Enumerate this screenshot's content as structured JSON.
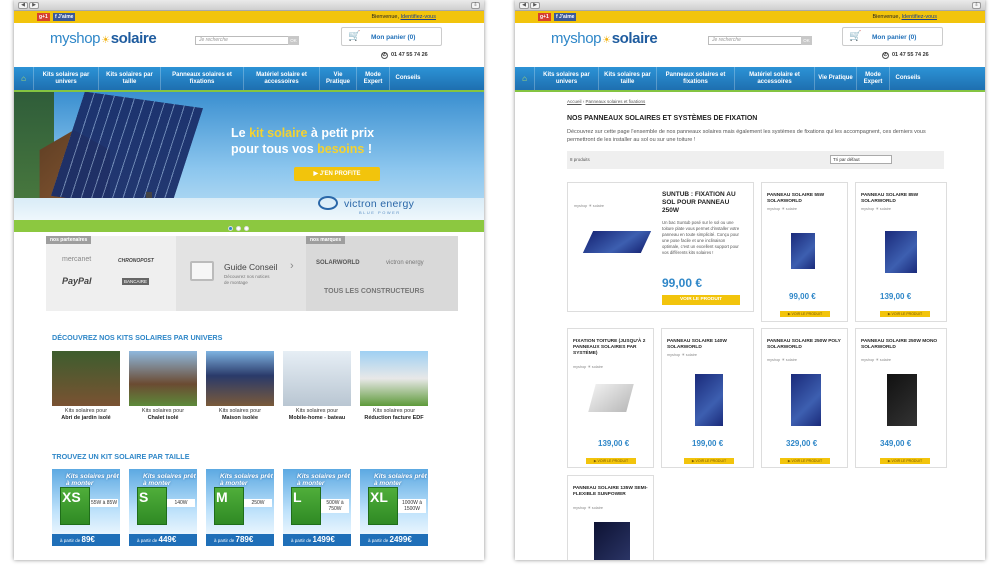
{
  "browser": {
    "back": "◀",
    "forward": "▶",
    "download": "⇩"
  },
  "common": {
    "social": {
      "gplus": "g+1",
      "fb": "f J'aime"
    },
    "welcome_text": "Bienvenue, ",
    "welcome_link": "Identifiez-vous",
    "logo": {
      "part1": "myshop",
      "sun": "☀",
      "part2": "solaire"
    },
    "search_placeholder": "Je recherche",
    "search_button": "OK",
    "cart_label": "Mon panier (0)",
    "cart_icon": "cart-icon",
    "phone": "01 47 55 74 26",
    "menu": [
      {
        "label": "Kits solaires par univers"
      },
      {
        "label": "Kits solaires par taille"
      },
      {
        "label": "Panneaux solaires et fixations"
      },
      {
        "label": "Matériel solaire et accessoires"
      },
      {
        "label": "Vie Pratique"
      },
      {
        "label": "Mode Expert"
      },
      {
        "label": "Conseils"
      }
    ]
  },
  "left": {
    "hero": {
      "line1_a": "Le ",
      "line1_b": "kit solaire",
      "line1_c": " à petit prix",
      "line2_a": "pour tous vos ",
      "line2_b": "besoins",
      "line2_c": " !",
      "cta": "▶ J'EN PROFITE",
      "brand": "victron energy",
      "brand_sub": "BLUE POWER"
    },
    "partners": {
      "label": "nos partenaires",
      "logos": [
        "mercanet",
        "CHRONOPOST",
        "PayPal",
        "BANCAIRE"
      ],
      "guide_title": "Guide Conseil",
      "guide_text": "Découvrez nos notices de montage",
      "guide_arrow": "›",
      "brands_label": "nos marques",
      "brand_logos": [
        "SOLARWORLD",
        "victron energy"
      ],
      "constructors": "TOUS LES CONSTRUCTEURS"
    },
    "univers_title": "DÉCOUVREZ NOS KITS SOLAIRES PAR UNIVERS",
    "univers": [
      {
        "l1": "Kits solaires pour",
        "l2": "Abri de jardin isolé"
      },
      {
        "l1": "Kits solaires pour",
        "l2": "Chalet isolé"
      },
      {
        "l1": "Kits solaires pour",
        "l2": "Maison isolée"
      },
      {
        "l1": "Kits solaires pour",
        "l2": "Mobile-home - bateau"
      },
      {
        "l1": "Kits solaires pour",
        "l2": "Réduction facture EDF"
      }
    ],
    "taille_title": "TROUVEZ UN KIT SOLAIRE PAR TAILLE",
    "tailles": [
      {
        "k": "Kits solaires prêt à monter",
        "size": "XS",
        "w": "55W à 85W",
        "from": "à partir de",
        "price": "89€"
      },
      {
        "k": "Kits solaires prêt à monter",
        "size": "S",
        "w": "140W",
        "from": "à partir de",
        "price": "449€"
      },
      {
        "k": "Kits solaires prêt à monter",
        "size": "M",
        "w": "250W",
        "from": "à partir de",
        "price": "789€"
      },
      {
        "k": "Kits solaires prêt à monter",
        "size": "L",
        "w": "500W à 750W",
        "from": "à partir de",
        "price": "1499€"
      },
      {
        "k": "Kits solaires prêt à monter",
        "size": "XL",
        "w": "1000W à 1500W",
        "from": "à partir de",
        "price": "2499€"
      }
    ]
  },
  "right": {
    "breadcrumb_home": "Accueil",
    "breadcrumb_sep": " › ",
    "breadcrumb_current": "Panneaux solaires et fixations",
    "title": "NOS PANNEAUX SOLAIRES ET SYSTÈMES DE FIXATION",
    "desc": "Découvrez sur cette page l'ensemble de nos panneaux solaires mais également les systèmes de fixations qui les accompagnent, ces derniers vous permettront de les installer au sol ou sur une toiture !",
    "count": "8 produits",
    "sort": "Tri par défaut",
    "brand_small": "myshop ☀ solaire",
    "btn": "▶ VOIR LE PRODUIT",
    "featured": {
      "name": "SUNTUB : FIXATION AU SOL POUR PANNEAU 250W",
      "desc": "Un bac Suntub posé sur le sol ou une toiture plate vous permet d'installer votre panneau en toute simplicité. Conçu pour une pose facile et une inclinaison optimale, c'est un excellent support pour vos différents kits solaires !",
      "price": "99,00 €",
      "btn": "VOIR LE PRODUIT"
    },
    "products": [
      {
        "name": "PANNEAU SOLAIRE 55W SOLARWORLD",
        "price": "99,00 €"
      },
      {
        "name": "PANNEAU SOLAIRE 85W SOLARWORLD",
        "price": "139,00 €"
      },
      {
        "name": "FIXATION TOITURE (JUSQU'À 2 PANNEAUX SOLAIRES PAR SYSTÈME)",
        "price": "139,00 €"
      },
      {
        "name": "PANNEAU SOLAIRE 140W SOLARWORLD",
        "price": "199,00 €"
      },
      {
        "name": "PANNEAU SOLAIRE 250W POLY SOLARWORLD",
        "price": "329,00 €"
      },
      {
        "name": "PANNEAU SOLAIRE 250W MONO SOLARWORLD",
        "price": "349,00 €"
      },
      {
        "name": "PANNEAU SOLAIRE 135W SEMI-FLEXIBLE SUNPOWER",
        "price": ""
      }
    ]
  }
}
